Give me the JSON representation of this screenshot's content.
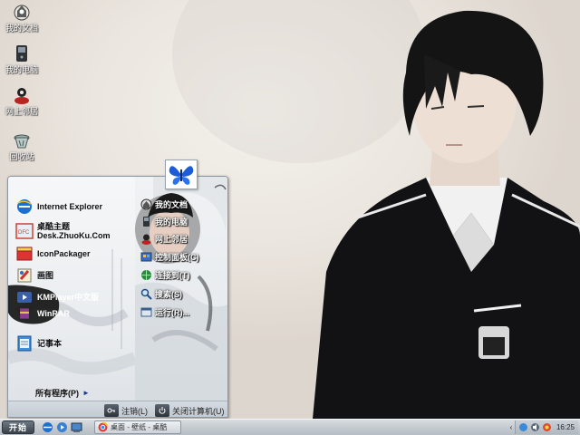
{
  "desktop": {
    "icons": [
      {
        "label": "我的文档",
        "icon": "my-documents-icon"
      },
      {
        "label": "我的电脑",
        "icon": "my-computer-icon"
      },
      {
        "label": "网上邻居",
        "icon": "network-neighborhood-icon"
      },
      {
        "label": "回收站",
        "icon": "recycle-bin-icon"
      }
    ]
  },
  "start_menu": {
    "pinned": [
      {
        "label": "Internet Explorer",
        "icon": "internet-explorer-icon"
      },
      {
        "label": "桌酷主题",
        "label2": "Desk.ZhuoKu.Com",
        "icon": "zhuoku-theme-icon"
      },
      {
        "label": "IconPackager",
        "icon": "iconpackager-icon"
      },
      {
        "label": "画图",
        "icon": "paint-icon"
      },
      {
        "label": "KMPlayer中文版",
        "icon": "kmplayer-icon"
      },
      {
        "label": "WinRAR",
        "icon": "winrar-icon"
      },
      {
        "label": "记事本",
        "icon": "notepad-icon"
      }
    ],
    "all_programs": "所有程序(P)",
    "all_programs_arrow": "►",
    "places": [
      {
        "label": "我的文档",
        "icon": "my-documents-icon"
      },
      {
        "label": "我的电脑",
        "icon": "my-computer-icon"
      },
      {
        "label": "网上邻居",
        "icon": "network-neighborhood-icon"
      },
      {
        "label": "控制面板(C)",
        "icon": "control-panel-icon"
      },
      {
        "label": "连接到(T)",
        "icon": "connect-to-icon"
      },
      {
        "label": "搜索(S)",
        "icon": "search-icon"
      },
      {
        "label": "运行(R)...",
        "icon": "run-icon"
      }
    ],
    "logoff": "注销(L)",
    "shutdown": "关闭计算机(U)"
  },
  "taskbar": {
    "start_label": "开始",
    "task_label": "桌面 - 壁纸 - 桌酷",
    "clock": "16:25"
  },
  "colors": {
    "taskbar": "#c3c9cf",
    "start_button": "#3b434c",
    "ie_blue": "#1f6fd1",
    "butterfly_blue": "#1d5bd8"
  }
}
